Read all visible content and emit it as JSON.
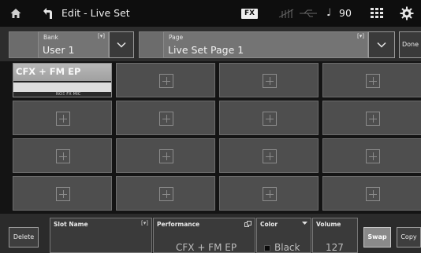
{
  "topbar": {
    "title": "Edit - Live Set",
    "fx_badge": "FX",
    "tempo": "90",
    "note_glyph": "♩"
  },
  "header": {
    "bank": {
      "label": "Bank",
      "value": "User 1",
      "mark": "[▾]"
    },
    "page": {
      "label": "Page",
      "value": "Live Set Page 1",
      "mark": "[▾]"
    },
    "done_label": "Done"
  },
  "slots": {
    "filled": {
      "name": "CFX + FM EP",
      "tags": "NOΞ FX MIC"
    },
    "empty_count": 15
  },
  "bottom": {
    "delete_label": "Delete",
    "slot_name": {
      "label": "Slot Name",
      "value": "",
      "mark": "[▾]"
    },
    "performance": {
      "label": "Performance",
      "value": "CFX + FM EP"
    },
    "color": {
      "label": "Color",
      "value": "Black"
    },
    "volume": {
      "label": "Volume",
      "value": "127"
    },
    "swap_label": "Swap",
    "copy_label": "Copy"
  },
  "colors": {
    "background": "#1b1b1b",
    "slot_empty": "#4e4e4e",
    "slot_filled": "#dddddd",
    "accent_swap": "#8a8a8a"
  },
  "icons": [
    "home-icon",
    "back-arrow-icon",
    "usb-icon",
    "note-icon",
    "grid-icon",
    "gear-icon",
    "chevron-down-icon",
    "plus-icon"
  ]
}
